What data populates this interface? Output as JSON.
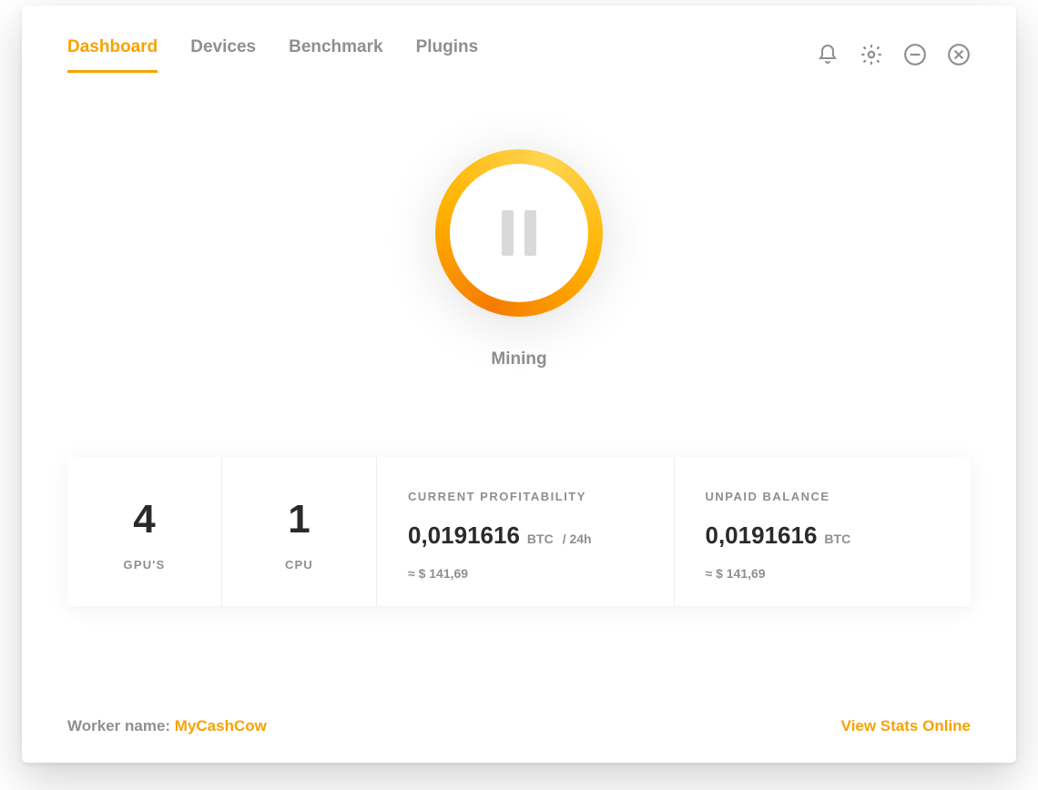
{
  "tabs": [
    {
      "label": "Dashboard",
      "active": true
    },
    {
      "label": "Devices",
      "active": false
    },
    {
      "label": "Benchmark",
      "active": false
    },
    {
      "label": "Plugins",
      "active": false
    }
  ],
  "mining": {
    "status_label": "Mining"
  },
  "stats": {
    "gpu": {
      "count": "4",
      "label": "GPU'S"
    },
    "cpu": {
      "count": "1",
      "label": "CPU"
    },
    "profitability": {
      "title": "CURRENT PROFITABILITY",
      "amount": "0,0191616",
      "unit": "BTC",
      "suffix": "/ 24h",
      "usd": "≈ $ 141,69"
    },
    "balance": {
      "title": "UNPAID BALANCE",
      "amount": "0,0191616",
      "unit": "BTC",
      "usd": "≈ $ 141,69"
    }
  },
  "footer": {
    "worker_label": "Worker name: ",
    "worker_name": "MyCashCow",
    "view_stats": "View Stats Online"
  }
}
